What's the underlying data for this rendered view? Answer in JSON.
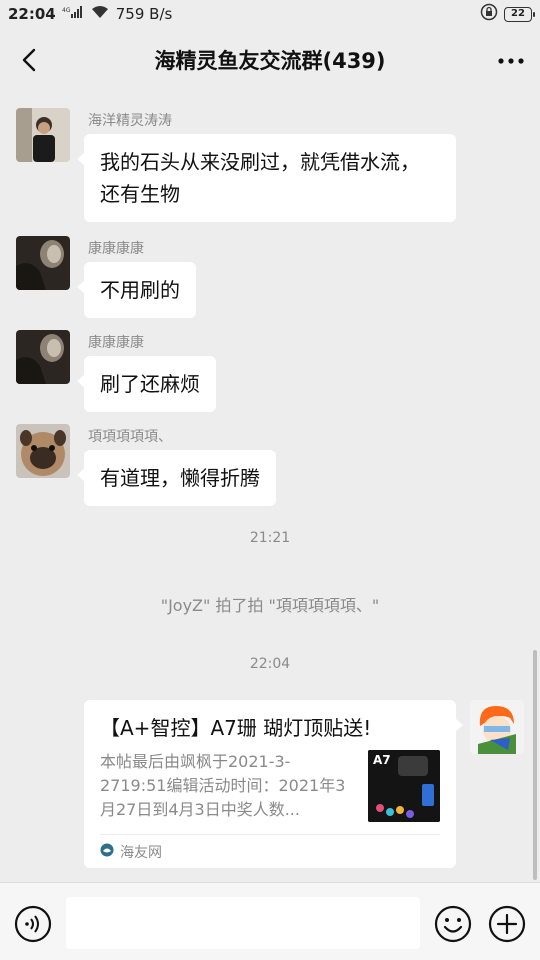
{
  "status_bar": {
    "time": "22:04",
    "network": "4G",
    "speed": "759 B/s",
    "battery": "22"
  },
  "header": {
    "title": "海精灵鱼友交流群(439)"
  },
  "messages": [
    {
      "sender": "海洋精灵涛涛",
      "text_line1": "我的石头从来没刷过，就凭借水流，",
      "text_line2": "还有生物"
    },
    {
      "sender": "康康康康",
      "text": "不用刷的"
    },
    {
      "sender": "康康康康",
      "text": "刷了还麻烦"
    },
    {
      "sender": "項項項項項、",
      "text": "有道理，懒得折腾"
    }
  ],
  "timestamps": [
    "21:21",
    "22:04"
  ],
  "system_message": "\"JoyZ\" 拍了拍 \"項項項項項、\"",
  "link_card": {
    "title": "【A+智控】A7珊 瑚灯顶贴送!",
    "description": "本帖最后由飒枫于2021-3-2719:51编辑活动时间：2021年3月27日到4月3日中奖人数...",
    "source": "海友网",
    "thumb_label": "A7"
  },
  "input": {
    "placeholder": ""
  },
  "colors": {
    "background": "#ededed",
    "bubble": "#ffffff",
    "meta_text": "#8a8a8a"
  }
}
